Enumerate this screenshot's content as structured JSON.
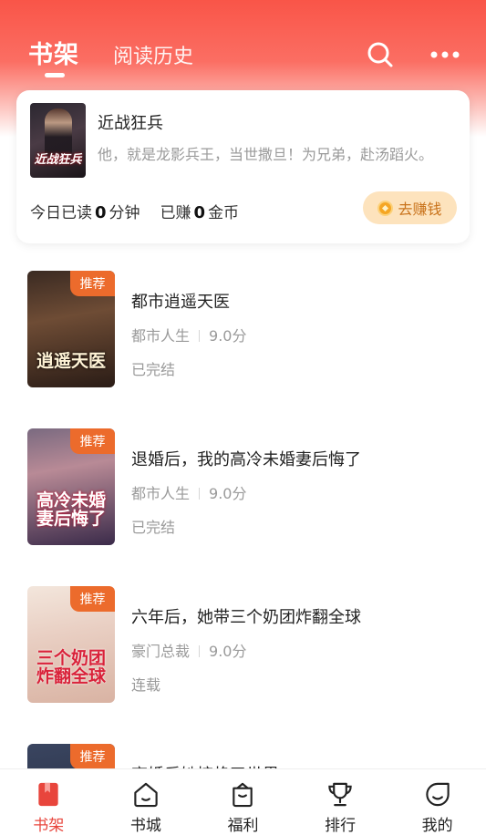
{
  "header": {
    "tabs": [
      {
        "label": "书架",
        "active": true
      },
      {
        "label": "阅读历史",
        "active": false
      }
    ],
    "icons": [
      "search-icon",
      "more-icon"
    ]
  },
  "current_reading": {
    "title": "近战狂兵",
    "cover_text": "近战狂兵",
    "description": "他，就是龙影兵王，当世撒旦！为兄弟，赴汤蹈火。",
    "read_today_prefix": "今日已读",
    "read_today_value": "0",
    "read_today_unit": "分钟",
    "earned_prefix": "已赚",
    "earned_value": "0",
    "earned_unit": "金币",
    "earn_button": "去赚钱"
  },
  "books": [
    {
      "title": "都市逍遥天医",
      "cover_text": "逍遥天医",
      "badge": "推荐",
      "category": "都市人生",
      "score": "9.0分",
      "status": "已完结"
    },
    {
      "title": "退婚后，我的高冷未婚妻后悔了",
      "cover_text": "高冷未婚妻后悔了",
      "badge": "推荐",
      "category": "都市人生",
      "score": "9.0分",
      "status": "已完结"
    },
    {
      "title": "六年后，她带三个奶团炸翻全球",
      "cover_text": "三个奶团炸翻全球",
      "badge": "推荐",
      "category": "豪门总裁",
      "score": "9.0分",
      "status": "连载"
    },
    {
      "title": "离婚后她惊艳了世界",
      "cover_text": "",
      "badge": "推荐",
      "category": "",
      "score": "",
      "status": ""
    }
  ],
  "bottom_nav": [
    {
      "label": "书架",
      "icon": "bookshelf-icon",
      "active": true
    },
    {
      "label": "书城",
      "icon": "bookstore-icon",
      "active": false
    },
    {
      "label": "福利",
      "icon": "welfare-icon",
      "active": false
    },
    {
      "label": "排行",
      "icon": "trophy-icon",
      "active": false
    },
    {
      "label": "我的",
      "icon": "profile-icon",
      "active": false
    }
  ],
  "colors": {
    "accent": "#e8453c",
    "header": "#f95548",
    "badge": "#ec6b2c",
    "earn_button_bg": "#fde3bd"
  }
}
